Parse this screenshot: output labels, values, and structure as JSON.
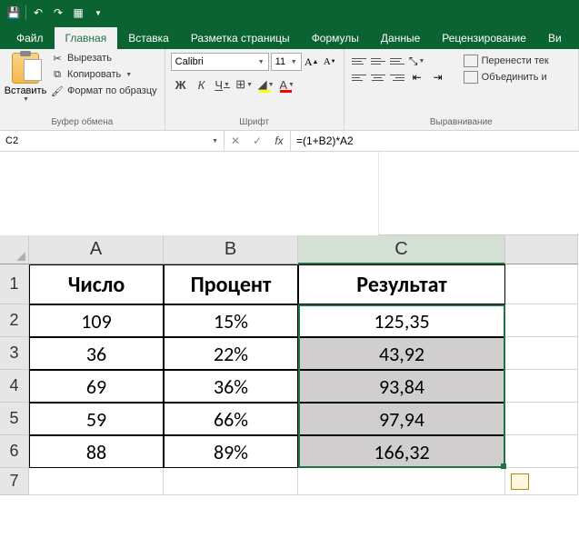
{
  "qat": {
    "save": "💾",
    "undo": "↶",
    "redo": "↷",
    "preview": "▦"
  },
  "tabs": {
    "file": "Файл",
    "home": "Главная",
    "insert": "Вставка",
    "layout": "Разметка страницы",
    "formulas": "Формулы",
    "data": "Данные",
    "review": "Рецензирование",
    "view": "Ви"
  },
  "ribbon": {
    "clipboard": {
      "paste": "Вставить",
      "cut": "Вырезать",
      "copy": "Копировать",
      "format_painter": "Формат по образцу",
      "group_label": "Буфер обмена"
    },
    "font": {
      "name": "Calibri",
      "size": "11",
      "group_label": "Шрифт",
      "bold": "Ж",
      "italic": "К",
      "underline": "Ч"
    },
    "alignment": {
      "wrap": "Перенести тек",
      "merge": "Объединить и",
      "group_label": "Выравнивание"
    }
  },
  "namebox": "C2",
  "formula": "=(1+B2)*A2",
  "columns": [
    "A",
    "B",
    "C"
  ],
  "rows": [
    "1",
    "2",
    "3",
    "4",
    "5",
    "6",
    "7"
  ],
  "headers": {
    "A": "Число",
    "B": "Процент",
    "C": "Результат"
  },
  "data_rows": [
    {
      "A": "109",
      "B": "15%",
      "C": "125,35"
    },
    {
      "A": "36",
      "B": "22%",
      "C": "43,92"
    },
    {
      "A": "69",
      "B": "36%",
      "C": "93,84"
    },
    {
      "A": "59",
      "B": "66%",
      "C": "97,94"
    },
    {
      "A": "88",
      "B": "89%",
      "C": "166,32"
    }
  ],
  "chart_data": {
    "type": "table",
    "title": "",
    "columns": [
      "Число",
      "Процент",
      "Результат"
    ],
    "rows": [
      [
        109,
        "15%",
        "125,35"
      ],
      [
        36,
        "22%",
        "43,92"
      ],
      [
        69,
        "36%",
        "93,84"
      ],
      [
        59,
        "66%",
        "97,94"
      ],
      [
        88,
        "89%",
        "166,32"
      ]
    ]
  }
}
